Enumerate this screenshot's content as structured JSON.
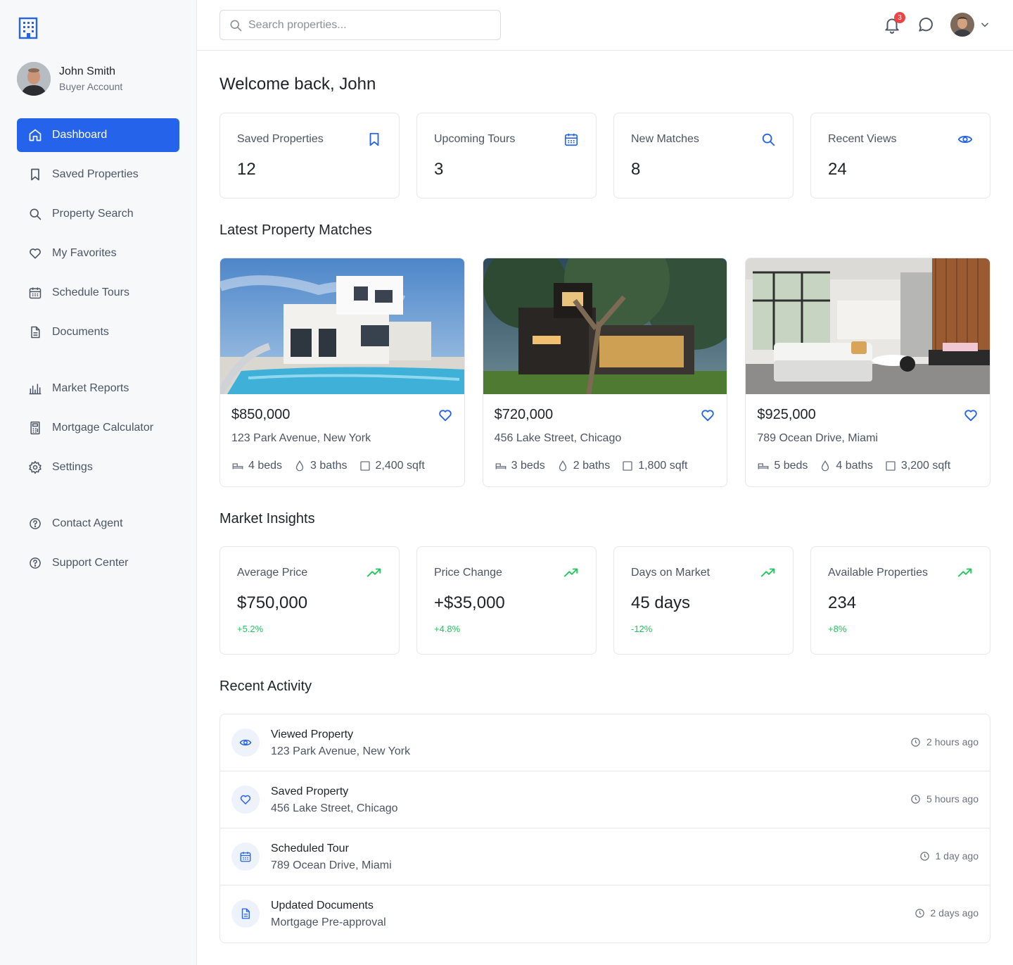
{
  "colors": {
    "accent": "#2563eb",
    "positive": "#22c55e",
    "badge": "#ef4444"
  },
  "user": {
    "name": "John Smith",
    "role": "Buyer Account"
  },
  "sidebar": {
    "primary": [
      {
        "label": "Dashboard",
        "icon": "home-icon",
        "active": true
      },
      {
        "label": "Saved Properties",
        "icon": "bookmark-icon"
      },
      {
        "label": "Property Search",
        "icon": "search-icon"
      },
      {
        "label": "My Favorites",
        "icon": "heart-icon"
      },
      {
        "label": "Schedule Tours",
        "icon": "calendar-icon"
      },
      {
        "label": "Documents",
        "icon": "document-icon"
      }
    ],
    "tools": [
      {
        "label": "Market Reports",
        "icon": "bar-chart-icon"
      },
      {
        "label": "Mortgage Calculator",
        "icon": "calculator-icon"
      },
      {
        "label": "Settings",
        "icon": "gear-icon"
      }
    ],
    "help": [
      {
        "label": "Contact Agent",
        "icon": "help-circle-icon"
      },
      {
        "label": "Support Center",
        "icon": "help-circle-icon"
      }
    ]
  },
  "header": {
    "search_placeholder": "Search properties...",
    "notification_count": "3"
  },
  "welcome": "Welcome back, John",
  "stats": [
    {
      "label": "Saved Properties",
      "value": "12",
      "icon": "bookmark-icon"
    },
    {
      "label": "Upcoming Tours",
      "value": "3",
      "icon": "calendar-icon"
    },
    {
      "label": "New Matches",
      "value": "8",
      "icon": "search-icon"
    },
    {
      "label": "Recent Views",
      "value": "24",
      "icon": "eye-icon"
    }
  ],
  "matches": {
    "title": "Latest Property Matches",
    "items": [
      {
        "price": "$850,000",
        "address": "123 Park Avenue, New York",
        "beds": "4 beds",
        "baths": "3 baths",
        "sqft": "2,400 sqft"
      },
      {
        "price": "$720,000",
        "address": "456 Lake Street, Chicago",
        "beds": "3 beds",
        "baths": "2 baths",
        "sqft": "1,800 sqft"
      },
      {
        "price": "$925,000",
        "address": "789 Ocean Drive, Miami",
        "beds": "5 beds",
        "baths": "4 baths",
        "sqft": "3,200 sqft"
      }
    ]
  },
  "insights": {
    "title": "Market Insights",
    "items": [
      {
        "label": "Average Price",
        "value": "$750,000",
        "change": "+5.2%",
        "icon": "trending-up-icon"
      },
      {
        "label": "Price Change",
        "value": "+$35,000",
        "change": "+4.8%",
        "icon": "trending-up-icon"
      },
      {
        "label": "Days on Market",
        "value": "45 days",
        "change": "-12%",
        "icon": "trending-up-icon"
      },
      {
        "label": "Available Properties",
        "value": "234",
        "change": "+8%",
        "icon": "trending-up-icon"
      }
    ]
  },
  "activity": {
    "title": "Recent Activity",
    "items": [
      {
        "title": "Viewed Property",
        "subtitle": "123 Park Avenue, New York",
        "time": "2 hours ago",
        "icon": "eye-icon"
      },
      {
        "title": "Saved Property",
        "subtitle": "456 Lake Street, Chicago",
        "time": "5 hours ago",
        "icon": "heart-icon"
      },
      {
        "title": "Scheduled Tour",
        "subtitle": "789 Ocean Drive, Miami",
        "time": "1 day ago",
        "icon": "calendar-icon"
      },
      {
        "title": "Updated Documents",
        "subtitle": "Mortgage Pre-approval",
        "time": "2 days ago",
        "icon": "document-icon"
      }
    ]
  }
}
